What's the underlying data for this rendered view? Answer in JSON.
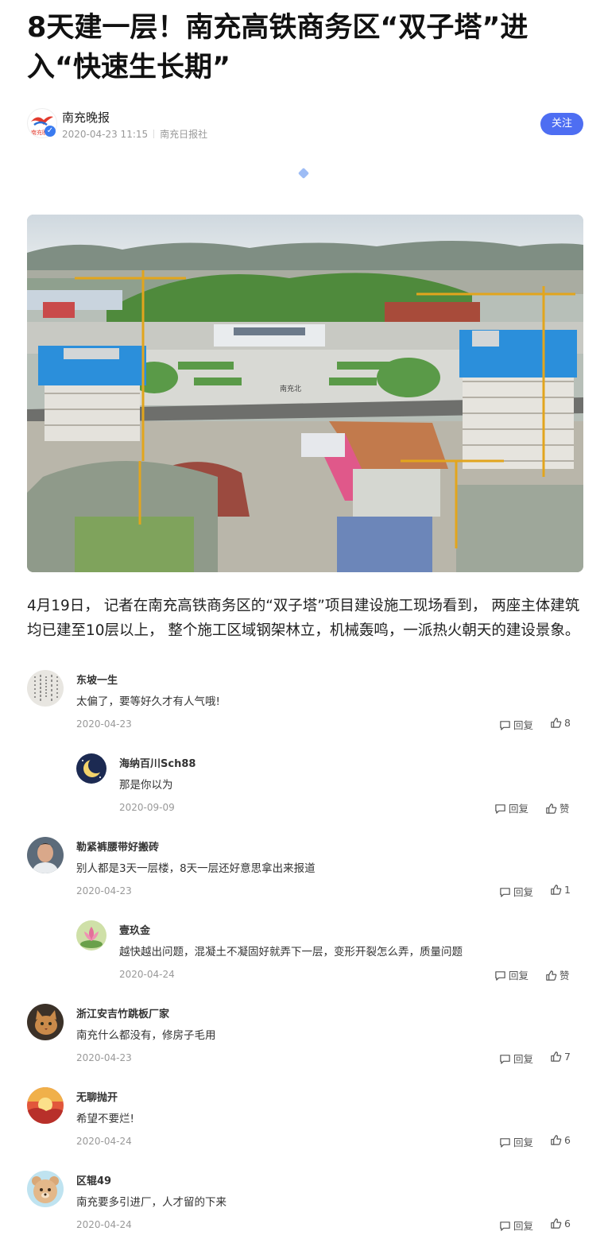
{
  "article": {
    "title": "8天建一层！南充高铁商务区“双子塔”进入“快速生长期”",
    "author": {
      "name": "南充晚报",
      "date": "2020-04-23 11:15",
      "source": "南充日报社",
      "follow_label": "关注",
      "logo_text": "南充晚报"
    },
    "body": "4月19日， 记者在南充高铁商务区的“双子塔”项目建设施工现场看到， 两座主体建筑均已建至10层以上， 整个施工区域钢架林立，机械轰鸣，一派热火朝天的建设景象。",
    "photo_sign": "南充北"
  },
  "colors": {
    "accent": "#4e6ef2",
    "date": "#999999"
  },
  "comments": [
    {
      "name": "东坡一生",
      "text": "太偏了，要等好久才有人气哦!",
      "date": "2020-04-23",
      "reply_label": "回复",
      "likes": "8",
      "avatar_icon": "calligraphy-avatar"
    },
    {
      "name": "海纳百川Sch88",
      "text": "那是你以为",
      "date": "2020-09-09",
      "reply_label": "回复",
      "likes": "赞",
      "avatar_icon": "moon-avatar"
    },
    {
      "name": "勒紧裤腰带好搬砖",
      "text": "别人都是3天一层楼，8天一层还好意思拿出来报道",
      "date": "2020-04-23",
      "reply_label": "回复",
      "likes": "1",
      "avatar_icon": "person-avatar"
    },
    {
      "name": "壹玖金",
      "text": "越快越出问题，混凝土不凝固好就弄下一层，变形开裂怎么弄，质量问题",
      "date": "2020-04-24",
      "reply_label": "回复",
      "likes": "赞",
      "avatar_icon": "lotus-avatar"
    },
    {
      "name": "浙江安吉竹跳板厂家",
      "text": "南充什么都没有，修房子毛用",
      "date": "2020-04-23",
      "reply_label": "回复",
      "likes": "7",
      "avatar_icon": "cat-avatar"
    },
    {
      "name": "无聊抛开",
      "text": "希望不要烂!",
      "date": "2020-04-24",
      "reply_label": "回复",
      "likes": "6",
      "avatar_icon": "sunset-avatar"
    },
    {
      "name": "区辊49",
      "text": "南充要多引进厂，人才留的下来",
      "date": "2020-04-24",
      "reply_label": "回复",
      "likes": "6",
      "avatar_icon": "bear-avatar"
    }
  ]
}
